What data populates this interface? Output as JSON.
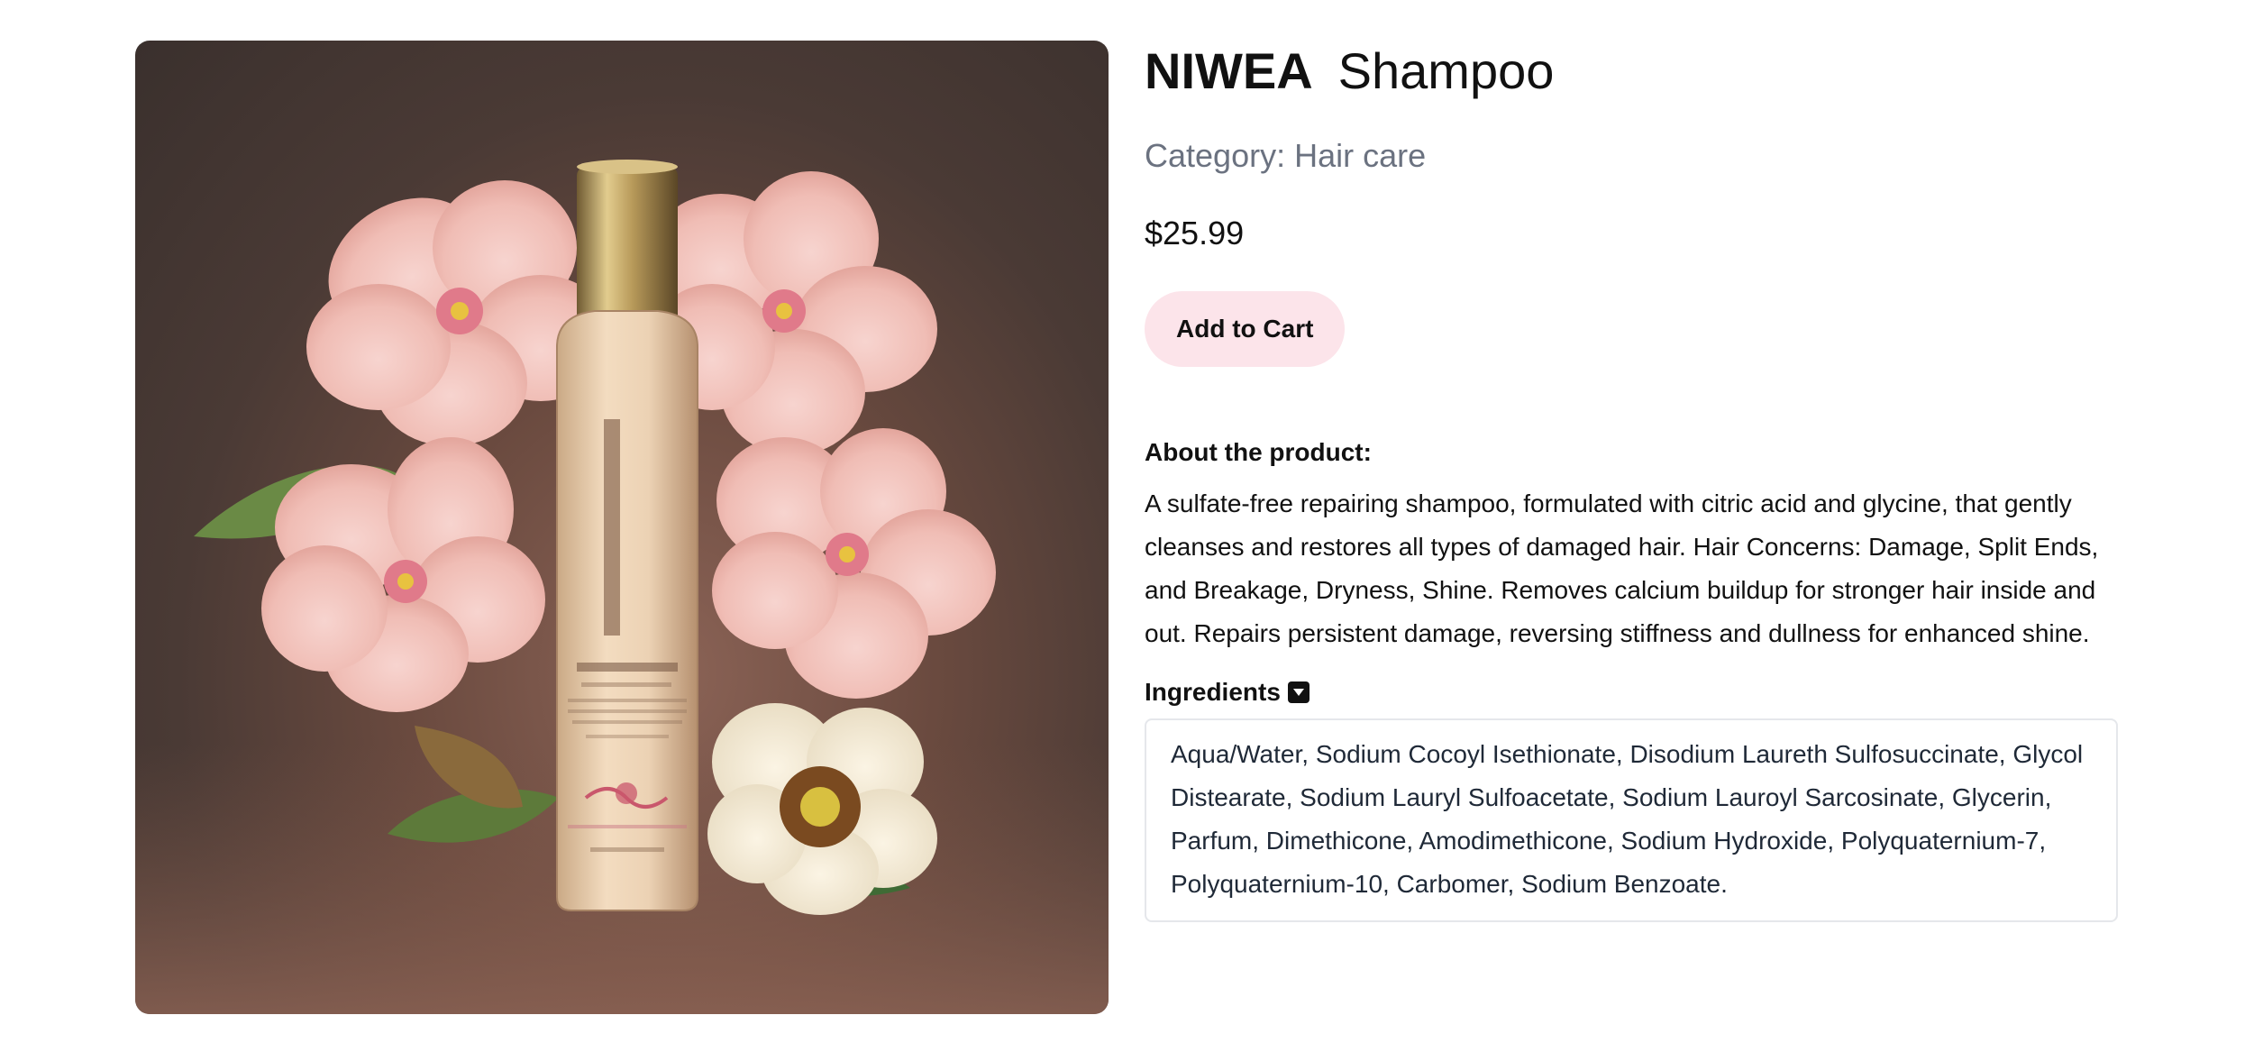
{
  "product": {
    "brand": "NIWEA",
    "name": "Shampoo",
    "category_label": "Category:",
    "category": "Hair care",
    "price": "$25.99",
    "image_alt": "Shampoo bottle with pink and white flowers"
  },
  "actions": {
    "add_to_cart": "Add to Cart"
  },
  "about": {
    "heading": "About the product:",
    "text": "A sulfate-free repairing shampoo, formulated with citric acid and glycine, that gently cleanses and restores all types of damaged hair. Hair Concerns: Damage, Split Ends, and Breakage, Dryness, Shine. Removes calcium buildup for stronger hair inside and out. Repairs persistent damage, reversing stiffness and dullness for enhanced shine."
  },
  "ingredients": {
    "heading": "Ingredients",
    "toggle_icon": "caret-down-square-icon",
    "text": "Aqua/Water, Sodium Cocoyl Isethionate, Disodium Laureth Sulfosuccinate, Glycol Distearate, Sodium Lauryl Sulfoacetate, Sodium Lauroyl Sarcosinate, Glycerin, Parfum, Dimethicone, Amodimethicone, Sodium Hydroxide, Polyquaternium-7, Polyquaternium-10, Carbomer, Sodium Benzoate."
  },
  "colors": {
    "button_bg": "#fce4ea",
    "category_text": "#6b7280"
  }
}
